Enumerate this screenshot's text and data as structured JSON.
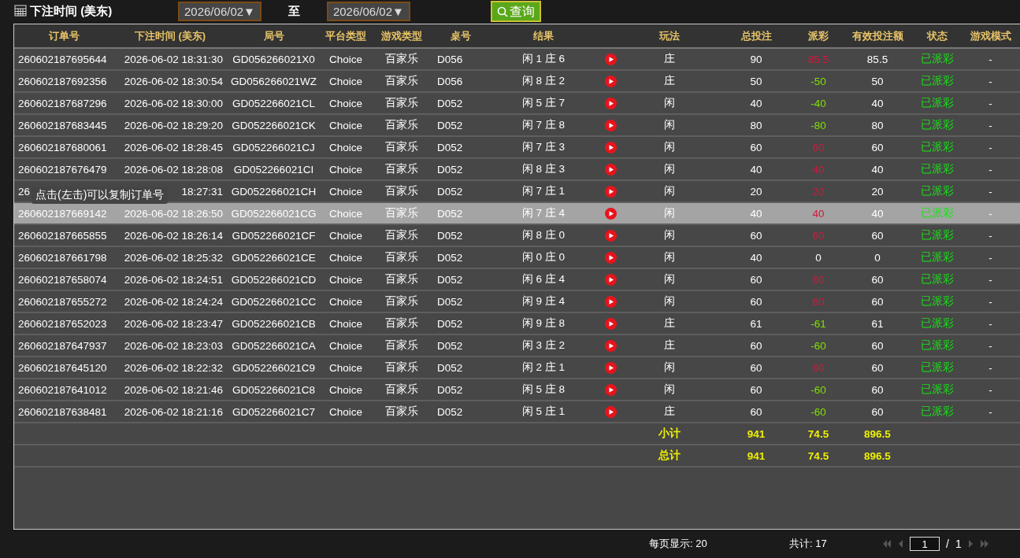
{
  "filter": {
    "label": "下注时间 (美东)",
    "from": "2026/06/02▼",
    "separator": "至",
    "to": "2026/06/02▼",
    "query_button": "查询"
  },
  "table": {
    "columns": [
      "订单号",
      "下注时间 (美东)",
      "局号",
      "平台类型",
      "游戏类型",
      "桌号",
      "结果",
      "玩法",
      "总投注",
      "派彩",
      "有效投注额",
      "状态",
      "游戏模式"
    ],
    "rows": [
      {
        "order": "260602187695644",
        "time": "2026-06-02 18:31:30",
        "round": "GD056266021X0",
        "platform": "Choice",
        "game": "百家乐",
        "table": "D056",
        "result": "闲 1 庄 6",
        "bet_type": "庄",
        "total_bet": "90",
        "payout": {
          "text": "85.5",
          "color": "#d6163c"
        },
        "valid_bet": "85.5",
        "status": "已派彩",
        "mode": "-",
        "selected": false
      },
      {
        "order": "260602187692356",
        "time": "2026-06-02 18:30:54",
        "round": "GD056266021WZ",
        "platform": "Choice",
        "game": "百家乐",
        "table": "D056",
        "result": "闲 8 庄 2",
        "bet_type": "庄",
        "total_bet": "50",
        "payout": {
          "text": "-50",
          "color": "#80e000"
        },
        "valid_bet": "50",
        "status": "已派彩",
        "mode": "-",
        "selected": false
      },
      {
        "order": "260602187687296",
        "time": "2026-06-02 18:30:00",
        "round": "GD052266021CL",
        "platform": "Choice",
        "game": "百家乐",
        "table": "D052",
        "result": "闲 5 庄 7",
        "bet_type": "闲",
        "total_bet": "40",
        "payout": {
          "text": "-40",
          "color": "#80e000"
        },
        "valid_bet": "40",
        "status": "已派彩",
        "mode": "-",
        "selected": false
      },
      {
        "order": "260602187683445",
        "time": "2026-06-02 18:29:20",
        "round": "GD052266021CK",
        "platform": "Choice",
        "game": "百家乐",
        "table": "D052",
        "result": "闲 7 庄 8",
        "bet_type": "闲",
        "total_bet": "80",
        "payout": {
          "text": "-80",
          "color": "#80e000"
        },
        "valid_bet": "80",
        "status": "已派彩",
        "mode": "-",
        "selected": false
      },
      {
        "order": "260602187680061",
        "time": "2026-06-02 18:28:45",
        "round": "GD052266021CJ",
        "platform": "Choice",
        "game": "百家乐",
        "table": "D052",
        "result": "闲 7 庄 3",
        "bet_type": "闲",
        "total_bet": "60",
        "payout": {
          "text": "60",
          "color": "#d6163c"
        },
        "valid_bet": "60",
        "status": "已派彩",
        "mode": "-",
        "selected": false
      },
      {
        "order": "260602187676479",
        "time": "2026-06-02 18:28:08",
        "round": "GD052266021CI",
        "platform": "Choice",
        "game": "百家乐",
        "table": "D052",
        "result": "闲 8 庄 3",
        "bet_type": "闲",
        "total_bet": "40",
        "payout": {
          "text": "40",
          "color": "#d6163c"
        },
        "valid_bet": "40",
        "status": "已派彩",
        "mode": "-",
        "selected": false
      },
      {
        "order": "26",
        "time": "18:27:31",
        "round": "GD052266021CH",
        "platform": "Choice",
        "game": "百家乐",
        "table": "D052",
        "result": "闲 7 庄 1",
        "bet_type": "闲",
        "total_bet": "20",
        "payout": {
          "text": "20",
          "color": "#d6163c"
        },
        "valid_bet": "20",
        "status": "已派彩",
        "mode": "-",
        "selected": false
      },
      {
        "order": "260602187669142",
        "time": "2026-06-02 18:26:50",
        "round": "GD052266021CG",
        "platform": "Choice",
        "game": "百家乐",
        "table": "D052",
        "result": "闲 7 庄 4",
        "bet_type": "闲",
        "total_bet": "40",
        "payout": {
          "text": "40",
          "color": "#d6163c"
        },
        "valid_bet": "40",
        "status": "已派彩",
        "mode": "-",
        "selected": true
      },
      {
        "order": "260602187665855",
        "time": "2026-06-02 18:26:14",
        "round": "GD052266021CF",
        "platform": "Choice",
        "game": "百家乐",
        "table": "D052",
        "result": "闲 8 庄 0",
        "bet_type": "闲",
        "total_bet": "60",
        "payout": {
          "text": "60",
          "color": "#d6163c"
        },
        "valid_bet": "60",
        "status": "已派彩",
        "mode": "-",
        "selected": false
      },
      {
        "order": "260602187661798",
        "time": "2026-06-02 18:25:32",
        "round": "GD052266021CE",
        "platform": "Choice",
        "game": "百家乐",
        "table": "D052",
        "result": "闲 0 庄 0",
        "bet_type": "闲",
        "total_bet": "40",
        "payout": {
          "text": "0",
          "color": "#ffffff"
        },
        "valid_bet": "0",
        "status": "已派彩",
        "mode": "-",
        "selected": false
      },
      {
        "order": "260602187658074",
        "time": "2026-06-02 18:24:51",
        "round": "GD052266021CD",
        "platform": "Choice",
        "game": "百家乐",
        "table": "D052",
        "result": "闲 6 庄 4",
        "bet_type": "闲",
        "total_bet": "60",
        "payout": {
          "text": "60",
          "color": "#d6163c"
        },
        "valid_bet": "60",
        "status": "已派彩",
        "mode": "-",
        "selected": false
      },
      {
        "order": "260602187655272",
        "time": "2026-06-02 18:24:24",
        "round": "GD052266021CC",
        "platform": "Choice",
        "game": "百家乐",
        "table": "D052",
        "result": "闲 9 庄 4",
        "bet_type": "闲",
        "total_bet": "60",
        "payout": {
          "text": "60",
          "color": "#d6163c"
        },
        "valid_bet": "60",
        "status": "已派彩",
        "mode": "-",
        "selected": false
      },
      {
        "order": "260602187652023",
        "time": "2026-06-02 18:23:47",
        "round": "GD052266021CB",
        "platform": "Choice",
        "game": "百家乐",
        "table": "D052",
        "result": "闲 9 庄 8",
        "bet_type": "庄",
        "total_bet": "61",
        "payout": {
          "text": "-61",
          "color": "#80e000"
        },
        "valid_bet": "61",
        "status": "已派彩",
        "mode": "-",
        "selected": false
      },
      {
        "order": "260602187647937",
        "time": "2026-06-02 18:23:03",
        "round": "GD052266021CA",
        "platform": "Choice",
        "game": "百家乐",
        "table": "D052",
        "result": "闲 3 庄 2",
        "bet_type": "庄",
        "total_bet": "60",
        "payout": {
          "text": "-60",
          "color": "#80e000"
        },
        "valid_bet": "60",
        "status": "已派彩",
        "mode": "-",
        "selected": false
      },
      {
        "order": "260602187645120",
        "time": "2026-06-02 18:22:32",
        "round": "GD052266021C9",
        "platform": "Choice",
        "game": "百家乐",
        "table": "D052",
        "result": "闲 2 庄 1",
        "bet_type": "闲",
        "total_bet": "60",
        "payout": {
          "text": "60",
          "color": "#d6163c"
        },
        "valid_bet": "60",
        "status": "已派彩",
        "mode": "-",
        "selected": false
      },
      {
        "order": "260602187641012",
        "time": "2026-06-02 18:21:46",
        "round": "GD052266021C8",
        "platform": "Choice",
        "game": "百家乐",
        "table": "D052",
        "result": "闲 5 庄 8",
        "bet_type": "闲",
        "total_bet": "60",
        "payout": {
          "text": "-60",
          "color": "#80e000"
        },
        "valid_bet": "60",
        "status": "已派彩",
        "mode": "-",
        "selected": false
      },
      {
        "order": "260602187638481",
        "time": "2026-06-02 18:21:16",
        "round": "GD052266021C7",
        "platform": "Choice",
        "game": "百家乐",
        "table": "D052",
        "result": "闲 5 庄 1",
        "bet_type": "庄",
        "total_bet": "60",
        "payout": {
          "text": "-60",
          "color": "#80e000"
        },
        "valid_bet": "60",
        "status": "已派彩",
        "mode": "-",
        "selected": false
      }
    ],
    "totals": [
      {
        "label": "小计",
        "total_bet": "941",
        "payout": "74.5",
        "valid_bet": "896.5"
      },
      {
        "label": "总计",
        "total_bet": "941",
        "payout": "74.5",
        "valid_bet": "896.5"
      }
    ]
  },
  "tooltip": "点击(左击)可以复制订单号",
  "footer": {
    "per_page": "每页显示: 20",
    "total": "共计: 17",
    "page": "1",
    "page_separator": "/",
    "page_count": "1"
  }
}
